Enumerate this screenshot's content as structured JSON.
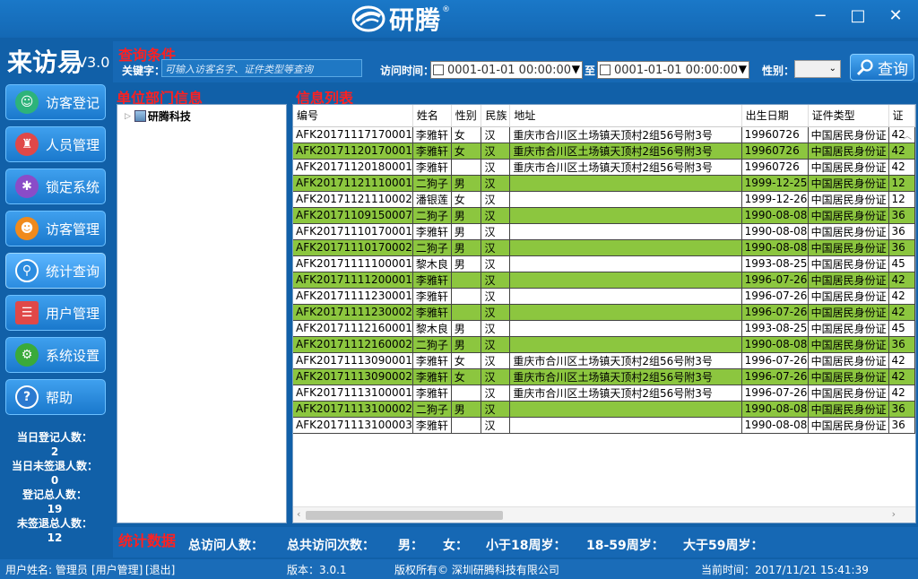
{
  "window": {
    "brand": "研腾",
    "brand_mark": "®",
    "minimize": "−",
    "maximize": "□",
    "close": "✕"
  },
  "app": {
    "name": "来访易",
    "version": "V3.0"
  },
  "nav": [
    {
      "label": "访客登记",
      "icon": "visitor-register-icon",
      "color": "#2db37a"
    },
    {
      "label": "人员管理",
      "icon": "person-manage-icon",
      "color": "#e04848"
    },
    {
      "label": "锁定系统",
      "icon": "lock-system-icon",
      "color": "#8a4cc8"
    },
    {
      "label": "访客管理",
      "icon": "visitor-manage-icon",
      "color": "#f08a1c"
    },
    {
      "label": "统计查询",
      "icon": "search-stats-icon",
      "color": "#2b8ce0"
    },
    {
      "label": "用户管理",
      "icon": "user-manage-icon",
      "color": "#e04848"
    },
    {
      "label": "系统设置",
      "icon": "settings-icon",
      "color": "#3aaa3a"
    },
    {
      "label": "帮助",
      "icon": "help-icon",
      "color": "#2b7ad0"
    }
  ],
  "stats_side": [
    {
      "label": "当日登记人数：",
      "value": "2"
    },
    {
      "label": "当日未签退人数：",
      "value": "0"
    },
    {
      "label": "登记总人数：",
      "value": "19"
    },
    {
      "label": "未签退总人数：",
      "value": "12"
    }
  ],
  "query": {
    "title": "查询条件",
    "keyword_label": "关键字：",
    "keyword_placeholder": "可输入访客名字、证件类型等查询",
    "time_label": "访问时间：",
    "date_from": "0001-01-01 00:00:00",
    "to_label": "至",
    "date_to": "0001-01-01 00:00:00",
    "sex_label": "性别：",
    "sex_value": "",
    "search_button": "查询"
  },
  "dept": {
    "title": "单位部门信息",
    "tree_root": "研腾科技"
  },
  "info": {
    "title": "信息列表",
    "columns": [
      "编号",
      "姓名",
      "性别",
      "民族",
      "地址",
      "出生日期",
      "证件类型",
      "证"
    ],
    "rows": [
      [
        "AFK20171117170001",
        "李雅轩",
        "女",
        "汉",
        "重庆市合川区土场镇天顶村2组56号附3号",
        "19960726",
        "中国居民身份证",
        "42"
      ],
      [
        "AFK20171120170001",
        "李雅轩",
        "女",
        "汉",
        "重庆市合川区土场镇天顶村2组56号附3号",
        "19960726",
        "中国居民身份证",
        "42"
      ],
      [
        "AFK20171120180001",
        "李雅轩",
        "",
        "汉",
        "重庆市合川区土场镇天顶村2组56号附3号",
        "19960726",
        "中国居民身份证",
        "42"
      ],
      [
        "AFK20171121110001",
        "二狗子",
        "男",
        "汉",
        "",
        "1999-12-25",
        "中国居民身份证",
        "12"
      ],
      [
        "AFK20171121110002",
        "潘银莲",
        "女",
        "汉",
        "",
        "1999-12-26",
        "中国居民身份证",
        "12"
      ],
      [
        "AFK20171109150007",
        "二狗子",
        "男",
        "汉",
        "",
        "1990-08-08",
        "中国居民身份证",
        "36"
      ],
      [
        "AFK20171110170001",
        "李雅轩",
        "男",
        "汉",
        "",
        "1990-08-08",
        "中国居民身份证",
        "36"
      ],
      [
        "AFK20171110170002",
        "二狗子",
        "男",
        "汉",
        "",
        "1990-08-08",
        "中国居民身份证",
        "36"
      ],
      [
        "AFK20171111100001",
        "黎木良",
        "男",
        "汉",
        "",
        "1993-08-25",
        "中国居民身份证",
        "45"
      ],
      [
        "AFK20171111200001",
        "李雅轩",
        "",
        "汉",
        "",
        "1996-07-26",
        "中国居民身份证",
        "42"
      ],
      [
        "AFK20171111230001",
        "李雅轩",
        "",
        "汉",
        "",
        "1996-07-26",
        "中国居民身份证",
        "42"
      ],
      [
        "AFK20171111230002",
        "李雅轩",
        "",
        "汉",
        "",
        "1996-07-26",
        "中国居民身份证",
        "42"
      ],
      [
        "AFK20171112160001",
        "黎木良",
        "男",
        "汉",
        "",
        "1993-08-25",
        "中国居民身份证",
        "45"
      ],
      [
        "AFK20171112160002",
        "二狗子",
        "男",
        "汉",
        "",
        "1990-08-08",
        "中国居民身份证",
        "36"
      ],
      [
        "AFK20171113090001",
        "李雅轩",
        "女",
        "汉",
        "重庆市合川区土场镇天顶村2组56号附3号",
        "1996-07-26",
        "中国居民身份证",
        "42"
      ],
      [
        "AFK20171113090002",
        "李雅轩",
        "女",
        "汉",
        "重庆市合川区土场镇天顶村2组56号附3号",
        "1996-07-26",
        "中国居民身份证",
        "42"
      ],
      [
        "AFK20171113100001",
        "李雅轩",
        "",
        "汉",
        "重庆市合川区土场镇天顶村2组56号附3号",
        "1996-07-26",
        "中国居民身份证",
        "42"
      ],
      [
        "AFK20171113100002",
        "二狗子",
        "男",
        "汉",
        "",
        "1990-08-08",
        "中国居民身份证",
        "36"
      ],
      [
        "AFK20171113100003",
        "李雅轩",
        "",
        "汉",
        "",
        "1990-08-08",
        "中国居民身份证",
        "36"
      ]
    ]
  },
  "stat_bar": {
    "title": "统计数据",
    "items": [
      "总访问人数：",
      "总共访问次数：",
      "男：",
      "女：",
      "小于18周岁：",
      "18-59周岁：",
      "大于59周岁："
    ]
  },
  "status": {
    "user": "用户姓名: 管理员",
    "user_manage": "[用户管理]",
    "logout": "[退出]",
    "version": "版本：3.0.1",
    "copyright": "版权所有© 深圳研腾科技有限公司",
    "time": "当前时间：2017/11/21 15:41:39"
  },
  "colors": {
    "row_green": "#8cc63f",
    "background": "#1160a8",
    "section_title": "#ff2020"
  }
}
